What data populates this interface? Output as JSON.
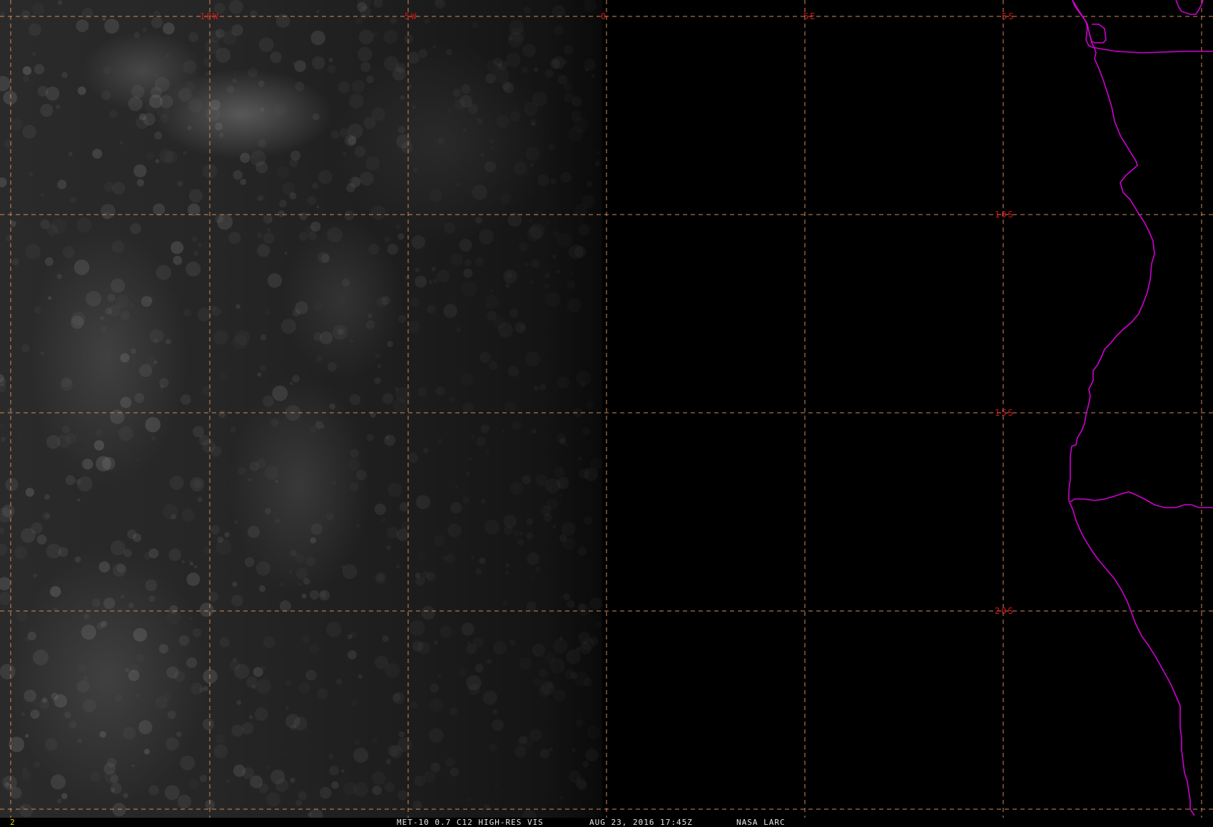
{
  "frame_number": "2",
  "caption": {
    "product": "MET-10 0.7 C12 HIGH-RES VIS",
    "datetime": "AUG 23, 2016 17:45Z",
    "source": "NASA LARC"
  },
  "longitude_labels": [
    "10W",
    "5W",
    "0",
    "5E"
  ],
  "latitude_labels": [
    "5S",
    "10S",
    "15S",
    "20S"
  ],
  "colors": {
    "grid": "#d08a5a",
    "grid_label": "#d01818",
    "coastline": "#d000d0",
    "frame_number": "#e8d800",
    "caption": "#e8e8e8"
  },
  "layers": [
    "visible-satellite-imagery",
    "lat-lon-grid",
    "political-boundaries"
  ]
}
